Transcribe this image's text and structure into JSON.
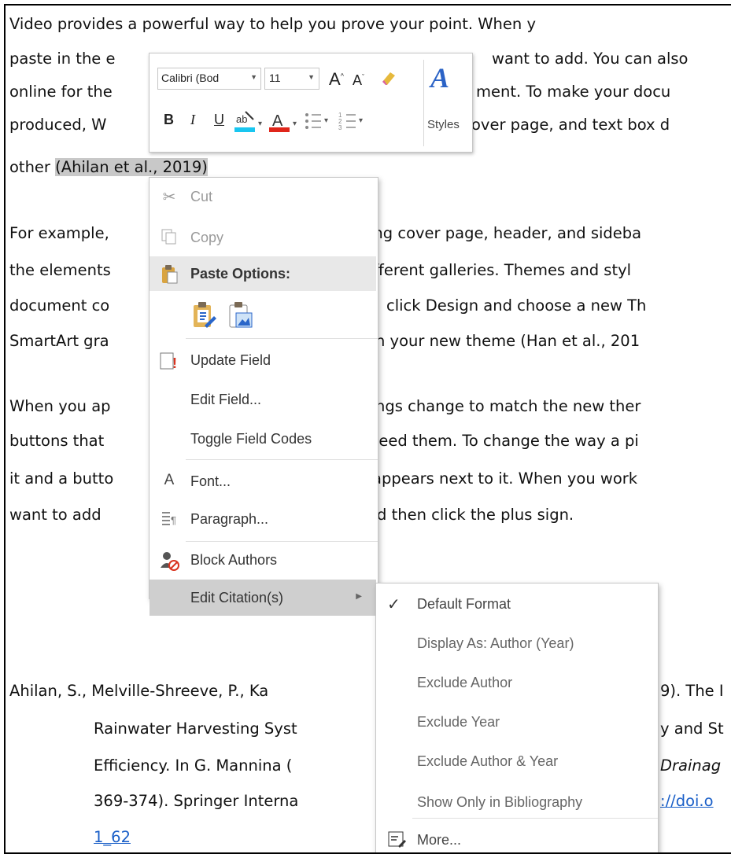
{
  "document": {
    "lines": [
      "Video provides a powerful way to help you prove your point. When y",
      "paste in the e",
      "want to add. You can also",
      "online for the",
      "ment. To make your docu",
      "produced, W",
      "over page, and text box d",
      "other ",
      "(Ahilan",
      " et al., 2019)"
    ],
    "para2": [
      "For example,",
      "ing cover page, header, and sideba",
      "the elements",
      "ifferent galleries. Themes and styl",
      "document co",
      "click Design and choose a new Th",
      "SmartArt gra",
      "h your new theme (Han et al., 201"
    ],
    "para3": [
      "When you ap",
      "ngs change to match the new ther",
      "buttons that",
      "need them. To change the way a pi",
      "it and a butto",
      "appears next to it. When you work",
      "want to add",
      "d then click the plus sign."
    ],
    "reference": [
      "Ahilan, S., Melville-Shreeve, P., Ka",
      "9). The I",
      "Rainwater Harvesting Syst",
      "y and St",
      "Efficiency. In G. Mannina (",
      "Drainag",
      "369-374). Springer Interna",
      "://doi.o",
      "1_62"
    ]
  },
  "mini_toolbar": {
    "font_name": "Calibri (Bod",
    "font_size": "11",
    "styles_label": "Styles",
    "grow_font": "A",
    "shrink_font": "A",
    "bold": "B",
    "italic": "I",
    "underline": "U",
    "font_color": "A",
    "styles_glyph": "A"
  },
  "context_menu": {
    "items": [
      {
        "label": "Cut",
        "icon": "scissors-icon",
        "disabled": true
      },
      {
        "label": "Copy",
        "icon": "copy-icon",
        "disabled": true
      },
      {
        "label": "Paste Options:",
        "icon": "paste-icon"
      },
      {
        "label": "Update Field",
        "icon": "update-field-icon"
      },
      {
        "label": "Edit Field...",
        "icon": ""
      },
      {
        "label": "Toggle Field Codes",
        "icon": ""
      },
      {
        "label": "Font...",
        "icon": "font-icon"
      },
      {
        "label": "Paragraph...",
        "icon": "paragraph-icon"
      },
      {
        "label": "Block Authors",
        "icon": "block-authors-icon"
      },
      {
        "label": "Edit Citation(s)",
        "icon": ""
      }
    ]
  },
  "submenu": {
    "items": [
      {
        "label": "Default Format",
        "checked": true
      },
      {
        "label": "Display As: Author (Year)"
      },
      {
        "label": "Exclude Author"
      },
      {
        "label": "Exclude Year"
      },
      {
        "label": "Exclude Author & Year"
      },
      {
        "label": "Show Only in Bibliography"
      },
      {
        "label": "More...",
        "icon": "more-icon"
      }
    ],
    "check_glyph": "✓"
  },
  "colors": {
    "highlight": "#c8c8c8",
    "menu_hover": "#cfcfcf",
    "link": "#1a5fc8",
    "styles_blue": "#2b63c6"
  }
}
